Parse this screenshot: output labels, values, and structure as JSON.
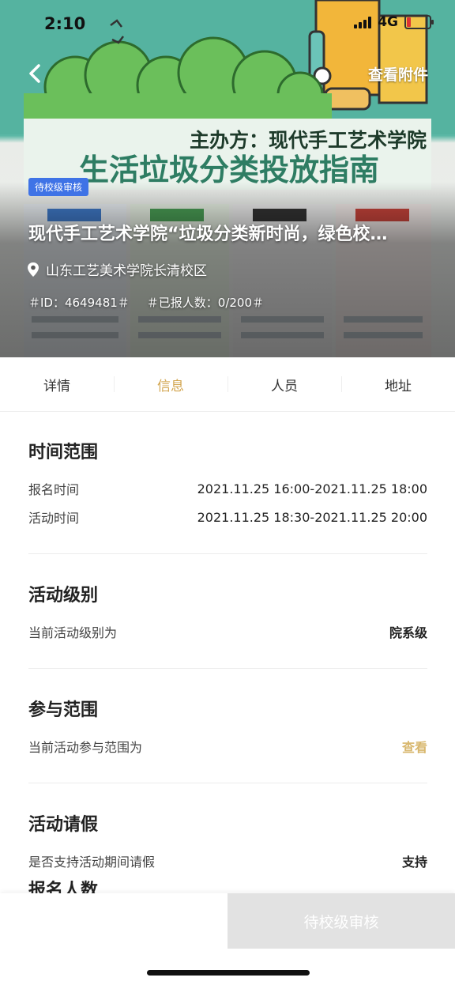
{
  "status_bar": {
    "time": "2:10",
    "network": "4G"
  },
  "header": {
    "attachment_label": "查看附件"
  },
  "poster": {
    "organizer": "主办方：现代手工艺术学院",
    "headline": "生活垃圾分类投放指南"
  },
  "hero": {
    "badge": "待校级审核",
    "title": "现代手工艺术学院“垃圾分类新时尚，绿色校…",
    "location": "山东工艺美术学院长清校区",
    "id_text": "＃ID：4649481＃",
    "enroll_text": "＃已报人数：0/200＃"
  },
  "tabs": [
    {
      "label": "详情",
      "active": false
    },
    {
      "label": "信息",
      "active": true
    },
    {
      "label": "人员",
      "active": false
    },
    {
      "label": "地址",
      "active": false
    }
  ],
  "sections": {
    "time_range": {
      "title": "时间范围",
      "signup_label": "报名时间",
      "signup_value": "2021.11.25 16:00-2021.11.25 18:00",
      "activity_label": "活动时间",
      "activity_value": "2021.11.25 18:30-2021.11.25 20:00"
    },
    "level": {
      "title": "活动级别",
      "label": "当前活动级别为",
      "value": "院系级"
    },
    "scope": {
      "title": "参与范围",
      "label": "当前活动参与范围为",
      "value": "查看"
    },
    "leave": {
      "title": "活动请假",
      "label": "是否支持活动期间请假",
      "value": "支持"
    },
    "enroll_peek": {
      "title": "报名人数"
    }
  },
  "bottom": {
    "action_label": "待校级审核"
  },
  "colors": {
    "accent": "#d2a54f",
    "badge": "#3f73e6",
    "disabled": "#e2e2e2"
  }
}
